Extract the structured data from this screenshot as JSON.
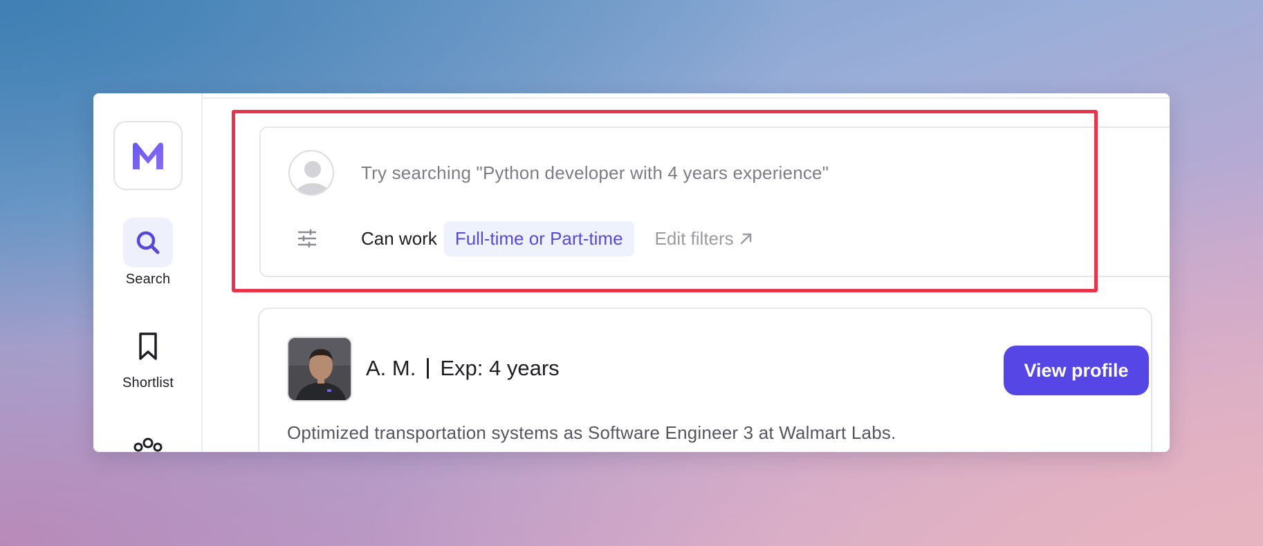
{
  "sidebar": {
    "logo_letter": "M",
    "items": [
      {
        "label": "Search",
        "icon": "search-icon",
        "active": true
      },
      {
        "label": "Shortlist",
        "icon": "bookmark-icon",
        "active": false
      },
      {
        "label": "",
        "icon": "team-icon",
        "active": false
      }
    ]
  },
  "search": {
    "placeholder": "Try searching \"Python developer with 4 years experience\"",
    "filter_label": "Can work",
    "filter_value": "Full-time or Part-time",
    "edit_filters_label": "Edit filters"
  },
  "result": {
    "name": "A. M.",
    "experience": "Exp: 4 years",
    "button_label": "View profile",
    "summary": "Optimized transportation systems as Software Engineer 3 at Walmart Labs."
  },
  "colors": {
    "accent": "#5646e6",
    "chip_text": "#5b47d6",
    "chip_bg": "#eef2fc",
    "highlight": "#e8334a"
  }
}
